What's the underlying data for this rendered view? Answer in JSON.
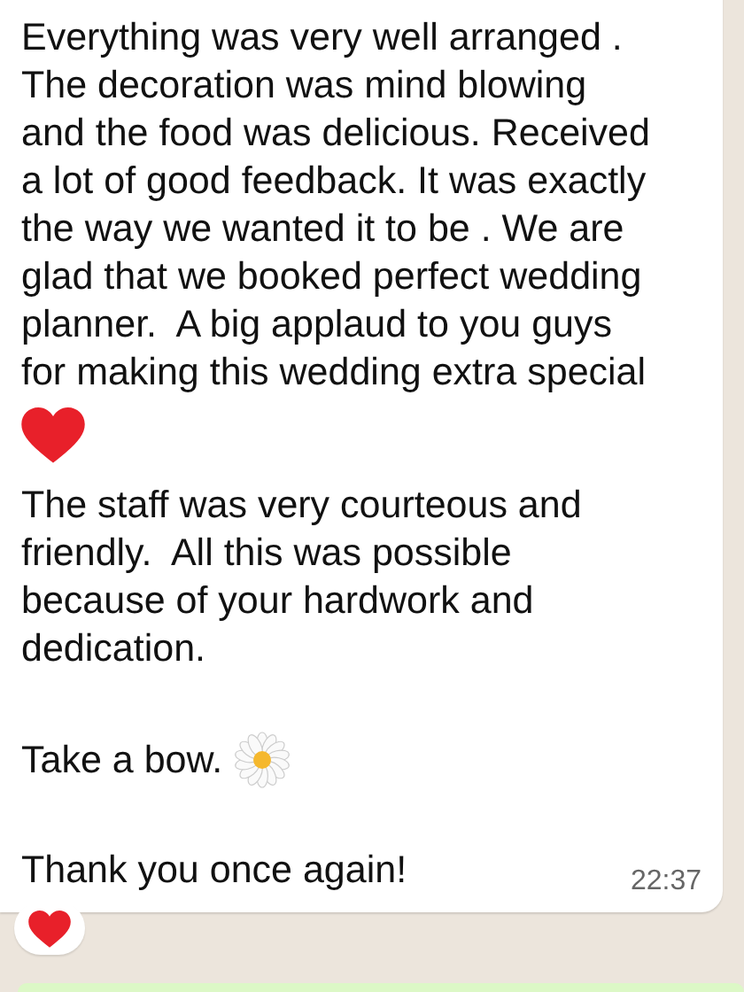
{
  "message": {
    "paragraphs": [
      {
        "text": "Everything was very well arranged .\nThe decoration was mind blowing\nand the food was delicious. Received\na lot of good feedback. It was exactly\nthe way we wanted it to be . We are\nglad that we booked perfect wedding\nplanner.  A big applaud to you guys\nfor making this wedding extra special",
        "emoji": {
          "kind": "heart"
        }
      },
      {
        "text": "The staff was very courteous and\nfriendly.  All this was possible\nbecause of your hardwork and\ndedication."
      },
      {
        "text": "Take a bow.",
        "emoji": {
          "kind": "daisy"
        }
      },
      {
        "text": "Thank you once again!"
      }
    ],
    "time": "22:37",
    "reaction": {
      "kind": "heart"
    }
  }
}
